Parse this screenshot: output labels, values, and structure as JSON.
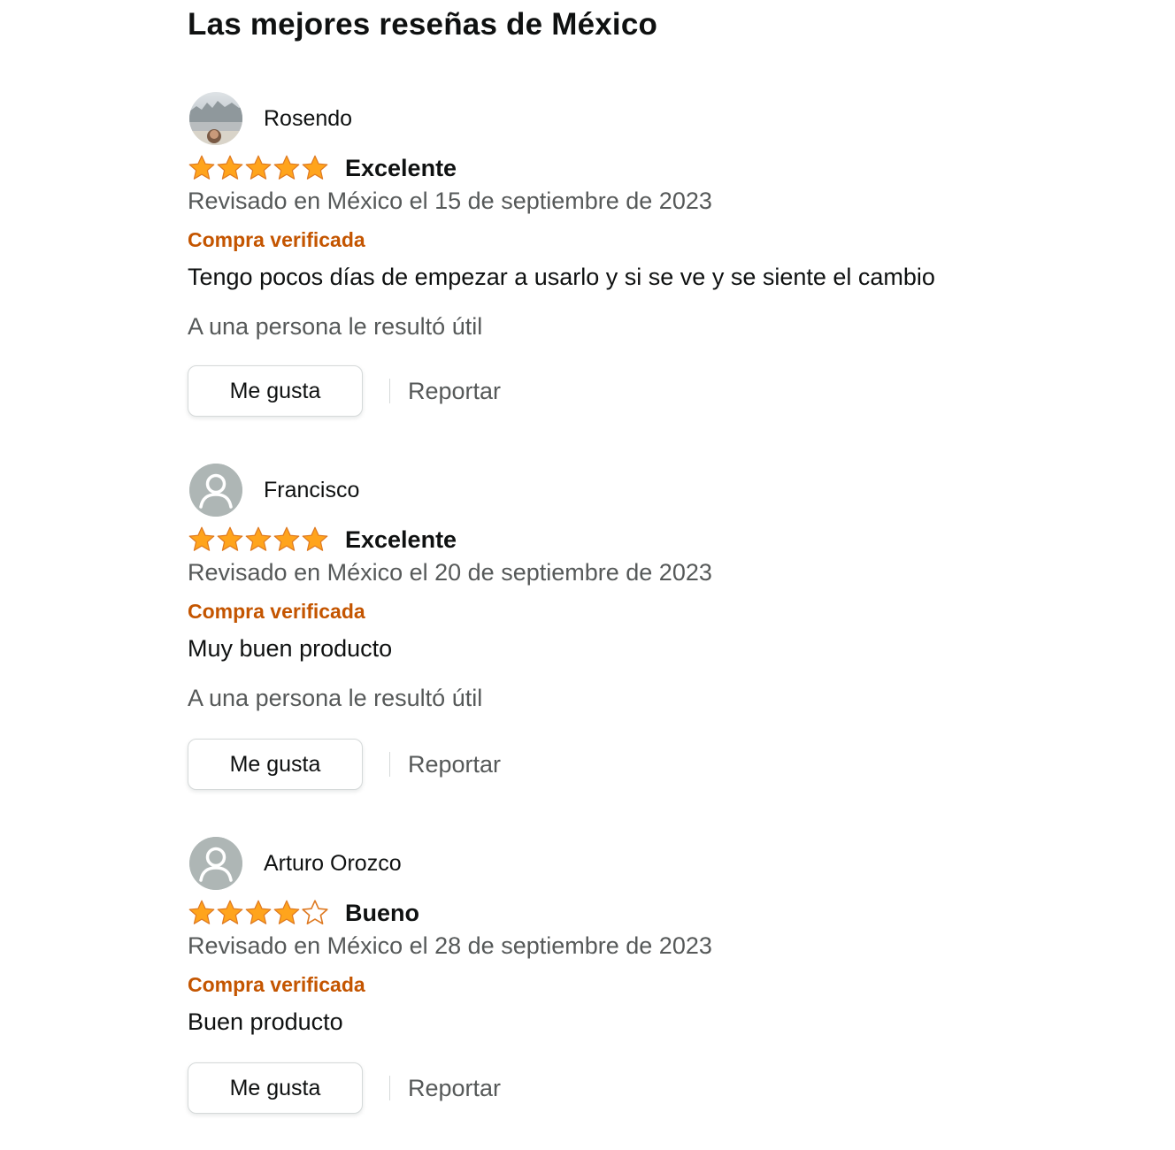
{
  "section_title": "Las mejores reseñas de México",
  "star_colors": {
    "filled": "#ffa41c",
    "outline": "#de7921"
  },
  "reviews": [
    {
      "author": "Rosendo",
      "avatar": "profile-photo",
      "rating": 5,
      "rating_max": 5,
      "title": "Excelente",
      "date": "Revisado en México el 15 de septiembre de 2023",
      "verified": "Compra verificada",
      "body": "Tengo pocos días de empezar a usarlo y si se ve y se siente el cambio",
      "helpful": "A una persona le resultó útil",
      "like_label": "Me gusta",
      "report_label": "Reportar"
    },
    {
      "author": "Francisco",
      "avatar": "default-user-icon",
      "rating": 5,
      "rating_max": 5,
      "title": "Excelente",
      "date": "Revisado en México el 20 de septiembre de 2023",
      "verified": "Compra verificada",
      "body": "Muy buen producto",
      "helpful": "A una persona le resultó útil",
      "like_label": "Me gusta",
      "report_label": "Reportar"
    },
    {
      "author": "Arturo Orozco",
      "avatar": "default-user-icon",
      "rating": 4,
      "rating_max": 5,
      "title": "Bueno",
      "date": "Revisado en México el 28 de septiembre de 2023",
      "verified": "Compra verificada",
      "body": "Buen producto",
      "helpful": "",
      "like_label": "Me gusta",
      "report_label": "Reportar"
    }
  ]
}
